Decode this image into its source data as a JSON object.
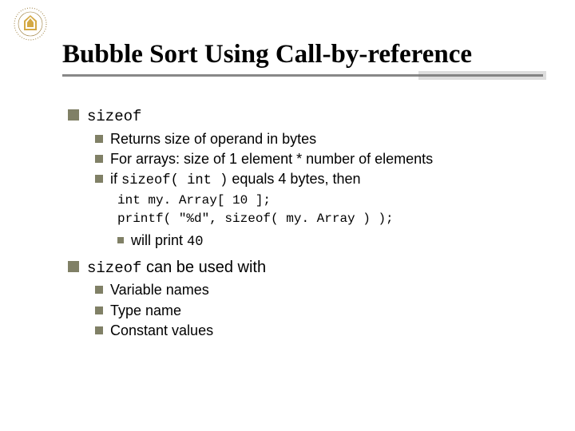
{
  "title": "Bubble Sort Using Call-by-reference",
  "b1a": "sizeof",
  "b1a_sub": {
    "i1": "Returns size of operand in bytes",
    "i2": "For arrays:  size of 1 element * number of elements",
    "i3_pre": "if ",
    "i3_code": "sizeof( int )",
    "i3_post": " equals 4 bytes, then"
  },
  "code": {
    "l1": "int my. Array[ 10 ];",
    "l2": "printf( \"%d\", sizeof( my. Array ) );"
  },
  "b1a_sub3": {
    "i1_pre": "will print ",
    "i1_code": "40"
  },
  "b1b_code": "sizeof",
  "b1b_post": " can be used with",
  "b1b_sub": {
    "i1": "Variable names",
    "i2": "Type name",
    "i3": "Constant values"
  }
}
